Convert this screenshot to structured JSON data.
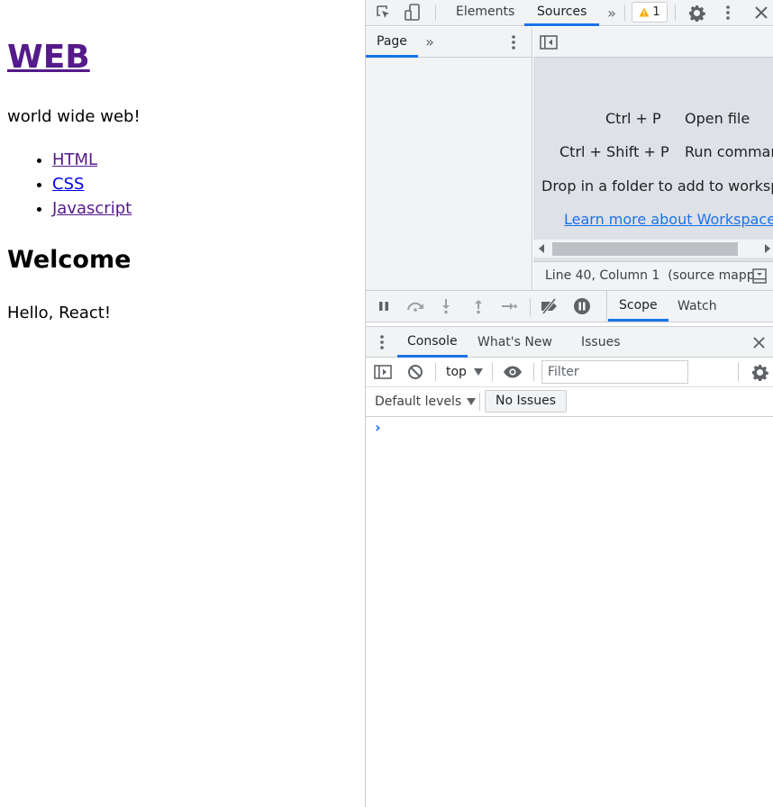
{
  "page": {
    "heading": "WEB",
    "tagline": "world wide web!",
    "links": [
      "HTML",
      "CSS",
      "Javascript"
    ],
    "subheading": "Welcome",
    "message": "Hello, React!"
  },
  "devtools": {
    "main_tabs": [
      "Elements",
      "Sources"
    ],
    "active_tab": "Sources",
    "warning_count": "1",
    "navigator_tab": "Page",
    "shortcuts": [
      {
        "keys": "Ctrl + P",
        "action": "Open file"
      },
      {
        "keys": "Ctrl + Shift + P",
        "action": "Run command"
      }
    ],
    "drop_text": "Drop in a folder to add to workspace",
    "learn_more": "Learn more about Workspaces",
    "status": "Line 40, Column 1  (source mapp",
    "side_tabs": [
      "Scope",
      "Watch"
    ],
    "drawer_tabs": [
      "Console",
      "What's New",
      "Issues"
    ],
    "context": "top",
    "filter_placeholder": "Filter",
    "levels": "Default levels",
    "no_issues": "No Issues",
    "prompt": "›"
  },
  "colors": {
    "visited_link": "#551a8b",
    "link": "#0000ee",
    "accent": "#1a73e8",
    "warning": "#f9ab00"
  }
}
